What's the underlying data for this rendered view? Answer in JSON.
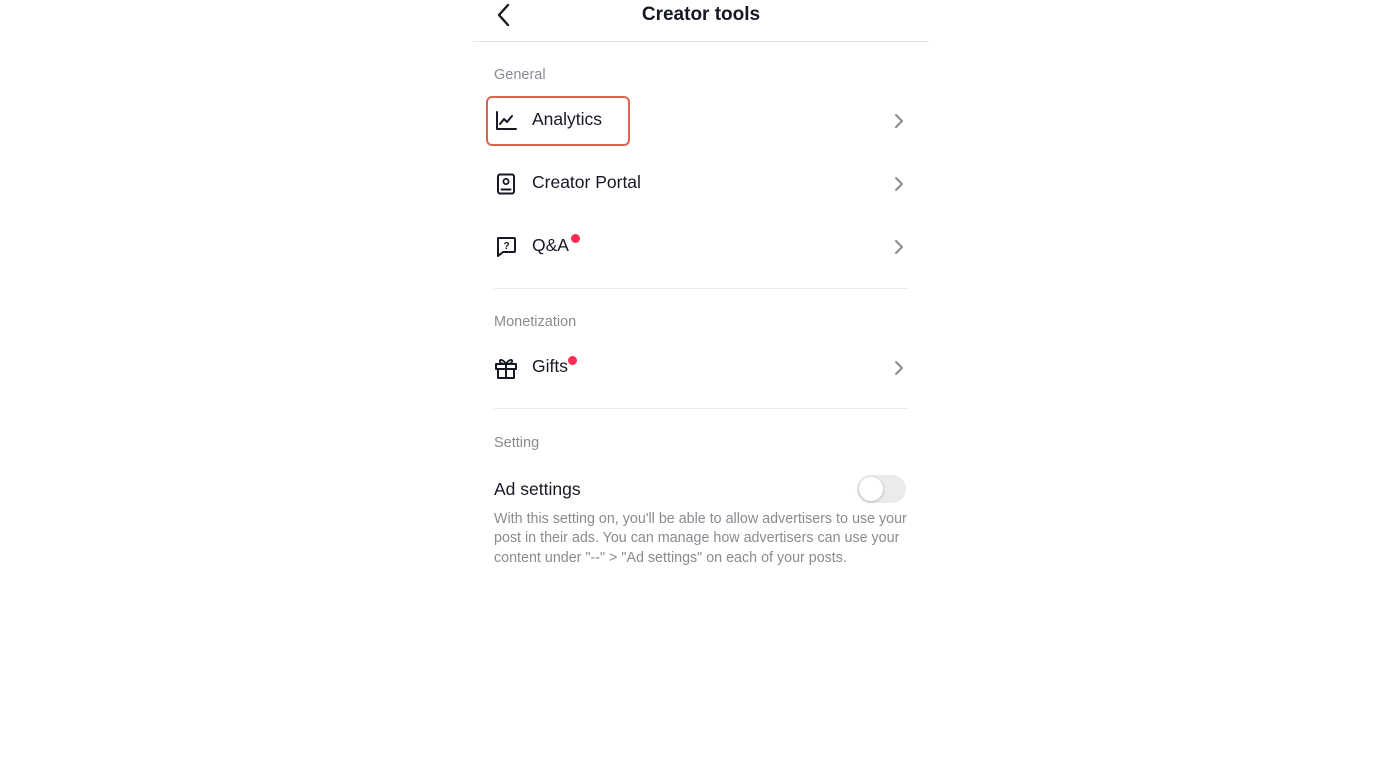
{
  "header": {
    "title": "Creator tools",
    "back_icon": "chevron-left-icon"
  },
  "sections": {
    "general": {
      "label": "General",
      "items": [
        {
          "label": "Analytics",
          "icon": "analytics-chart-icon",
          "badge": false,
          "highlighted": true
        },
        {
          "label": "Creator Portal",
          "icon": "creator-portal-icon",
          "badge": false
        },
        {
          "label": "Q&A",
          "icon": "qa-icon",
          "badge": true
        }
      ]
    },
    "monetization": {
      "label": "Monetization",
      "items": [
        {
          "label": "Gifts",
          "icon": "gift-icon",
          "badge": true
        }
      ]
    },
    "setting": {
      "label": "Setting",
      "ad_settings": {
        "label": "Ad settings",
        "enabled": false,
        "description": "With this setting on, you'll be able to allow advertisers to use your post in their ads. You can manage how advertisers can use your content under \"--\" > \"Ad settings\" on each of your posts."
      }
    }
  },
  "colors": {
    "badge": "#fe2c55",
    "highlight_border": "#d9664f",
    "secondary_text": "#8a8b91"
  }
}
